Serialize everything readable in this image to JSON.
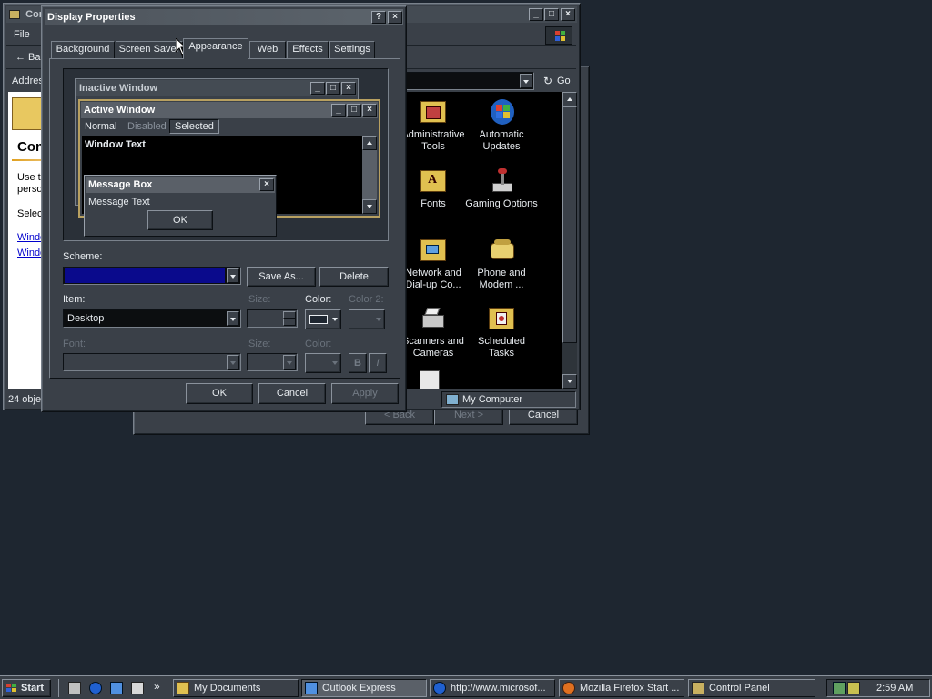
{
  "control_panel": {
    "title": "Control Panel",
    "menu_file": "File",
    "back_label": "Back",
    "address_label": "Address",
    "go_label": "Go",
    "heading": "Control Panel",
    "desc_1": "Use the settings in Control Panel to",
    "desc_2": "personalize your computer.",
    "select_text": "Select an item to view its description.",
    "link_1": "Windows Update",
    "link_2": "Windows 2000 Support",
    "status_left": "24 objects",
    "status_right": "My Computer",
    "icons": [
      {
        "label": "Administrative Tools",
        "name": "administrative-tools-icon"
      },
      {
        "label": "Automatic Updates",
        "name": "automatic-updates-icon"
      },
      {
        "label": "Fonts",
        "name": "fonts-icon"
      },
      {
        "label": "Gaming Options",
        "name": "gaming-options-icon"
      },
      {
        "label": "Network and Dial-up Co...",
        "name": "network-connections-icon"
      },
      {
        "label": "Phone and Modem ...",
        "name": "phone-modem-icon"
      },
      {
        "label": "Scanners and Cameras",
        "name": "scanners-cameras-icon"
      },
      {
        "label": "Scheduled Tasks",
        "name": "scheduled-tasks-icon"
      }
    ]
  },
  "wizard_behind": {
    "back_label": "< Back",
    "next_label": "Next >",
    "cancel_label": "Cancel"
  },
  "display_props": {
    "title": "Display Properties",
    "help_btn": "?",
    "close_btn": "×",
    "tabs": [
      "Background",
      "Screen Saver",
      "Appearance",
      "Web",
      "Effects",
      "Settings"
    ],
    "active_tab": "Appearance",
    "preview": {
      "inactive_title": "Inactive Window",
      "active_title": "Active Window",
      "menu_normal": "Normal",
      "menu_disabled": "Disabled",
      "menu_selected": "Selected",
      "window_text": "Window Text",
      "msgbox_title": "Message Box",
      "msgbox_text": "Message Text",
      "msgbox_ok": "OK"
    },
    "scheme_label": "Scheme:",
    "scheme_color": "#0a0a8c",
    "save_as_label": "Save As...",
    "delete_label": "Delete",
    "item_label": "Item:",
    "item_value": "Desktop",
    "size_label": "Size:",
    "color_label": "Color:",
    "color2_label": "Color 2:",
    "font_label": "Font:",
    "font_size_label": "Size:",
    "font_color_label": "Color:",
    "bold_label": "B",
    "italic_label": "I",
    "ok_label": "OK",
    "cancel_label": "Cancel",
    "apply_label": "Apply"
  },
  "taskbar": {
    "start_label": "Start",
    "chevron": "»",
    "items": [
      {
        "label": "My Documents",
        "active": false
      },
      {
        "label": "Outlook Express",
        "active": true
      },
      {
        "label": "http://www.microsof...",
        "active": false
      },
      {
        "label": "Mozilla Firefox Start ...",
        "active": false
      },
      {
        "label": "Control Panel",
        "active": false
      }
    ],
    "clock": "2:59 AM"
  }
}
